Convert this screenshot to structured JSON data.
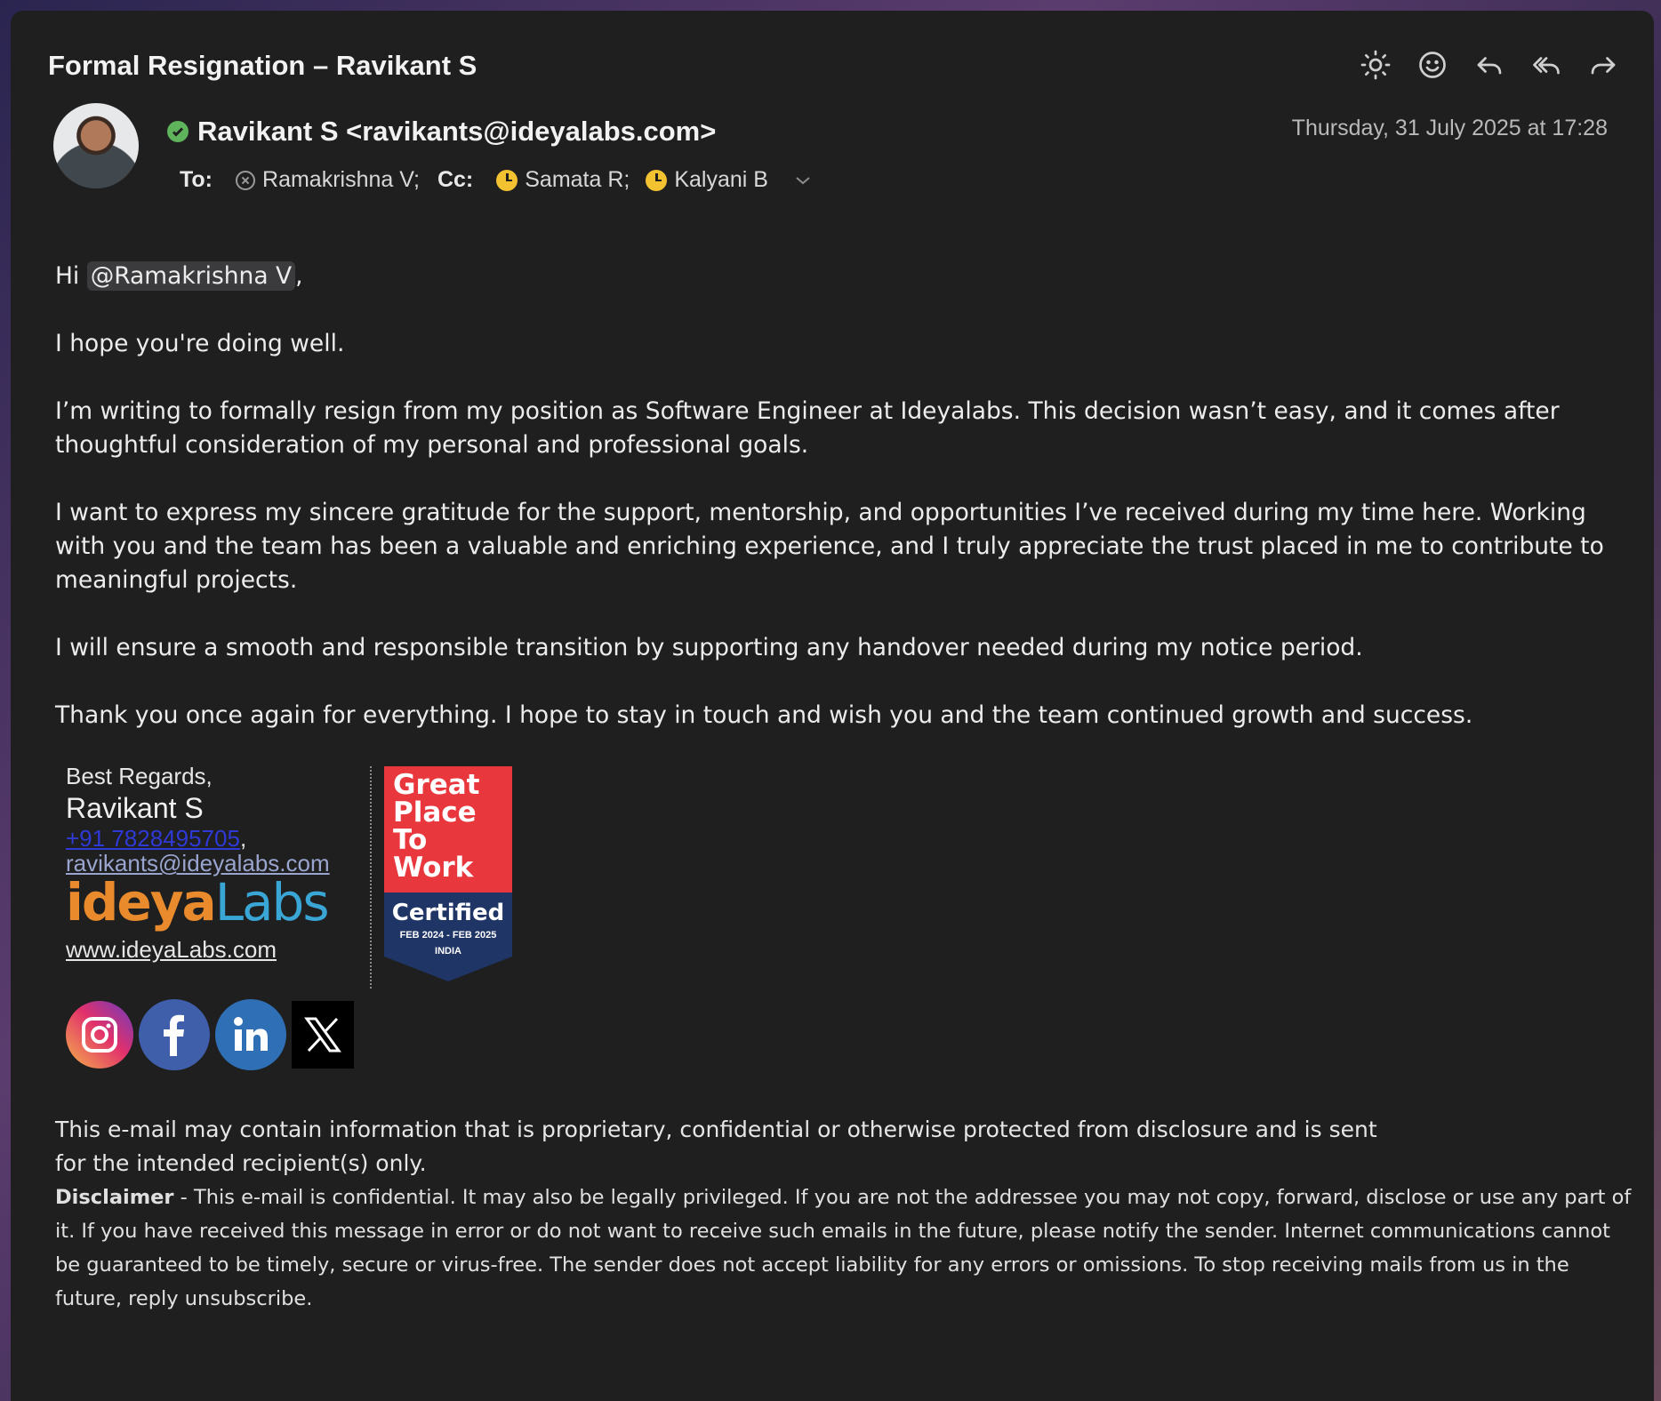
{
  "email": {
    "subject": "Formal Resignation – Ravikant S",
    "sender": "Ravikant S <ravikants@ideyalabs.com>",
    "date": "Thursday, 31 July 2025 at 17:28",
    "to_label": "To:",
    "cc_label": "Cc:",
    "to": [
      {
        "name": "Ramakrishna V;"
      }
    ],
    "cc": [
      {
        "name": "Samata R;"
      },
      {
        "name": "Kalyani B"
      }
    ]
  },
  "toolbar": {
    "icons": [
      "brightness-icon",
      "emoji-icon",
      "reply-icon",
      "reply-all-icon",
      "forward-icon"
    ]
  },
  "body": {
    "greeting_prefix": "Hi ",
    "mention": "@Ramakrishna V",
    "greeting_suffix": ",",
    "p1": "I hope you're doing well.",
    "p2": "I’m writing to formally resign from my position as Software Engineer at Ideyalabs. This decision wasn’t easy, and it comes after thoughtful consideration of my personal and professional goals.",
    "p3": "I want to express my sincere gratitude for the support, mentorship, and opportunities I’ve received during my time here. Working with you and the team has been a valuable and enriching experience, and I truly appreciate the trust placed in me to contribute to meaningful projects.",
    "p4": "I will ensure a smooth and responsible transition by supporting any handover needed during my notice period.",
    "p5": "Thank you once again for everything. I hope to stay in touch and wish you and the team continued growth and success."
  },
  "signature": {
    "regards": "Best Regards,",
    "name": "Ravikant S",
    "phone": "+91 7828495705",
    "phone_sep": ",",
    "email": "ravikants@ideyalabs.com",
    "logo_part1": "ideya",
    "logo_part2": "Labs",
    "website": "www.ideyaLabs.com",
    "badge": {
      "line1": "Great",
      "line2": "Place",
      "line3": "To",
      "line4": "Work",
      "certified": "Certified",
      "dates": "FEB 2024 - FEB 2025",
      "country": "INDIA"
    },
    "social": [
      "instagram-icon",
      "facebook-icon",
      "linkedin-icon",
      "x-icon"
    ]
  },
  "notice": {
    "confidential": "This e-mail may contain information that is proprietary, confidential or otherwise protected from disclosure and is sent for the intended recipient(s) only.",
    "disclaimer_label": "Disclaimer",
    "disclaimer_text": " - This e-mail is confidential. It may also be legally privileged. If you are not the addressee you may not copy, forward, disclose or use any part of it. If you have received this message in error or do not want to receive such emails in the future, please notify the sender. Internet communications cannot be guaranteed to be timely, secure or virus-free. The sender does not accept liability for any errors or omissions. To stop receiving mails from us in the future, reply unsubscribe."
  },
  "colors": {
    "background": "#1f1f20",
    "verified": "#5fb35b",
    "pending": "#f2c230",
    "link_phone": "#2f39d6",
    "badge_red": "#e8383d",
    "badge_navy": "#1e3566"
  }
}
